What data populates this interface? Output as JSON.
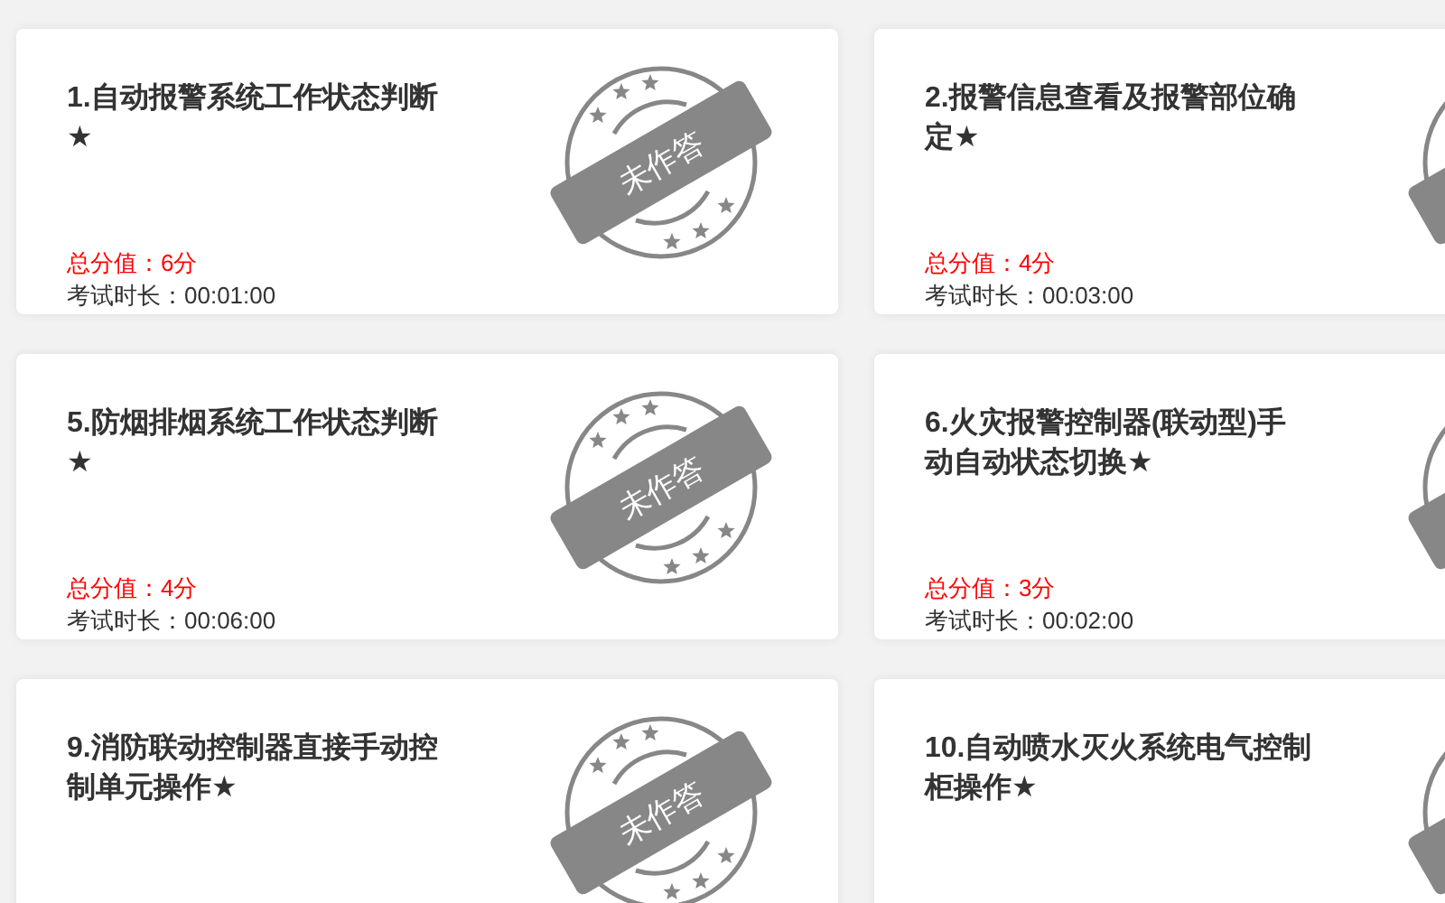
{
  "cards": [
    {
      "title": "1.自动报警系统工作状态判断★",
      "score": "总分值：6分",
      "duration": "考试时长：00:01:00",
      "stamp": {
        "kind": "unanswered",
        "label": "未作答"
      }
    },
    {
      "title": "2.报警信息查看及报警部位确定★",
      "score": "总分值：4分",
      "duration": "考试时长：00:03:00",
      "stamp": {
        "kind": "unanswered"
      }
    },
    {
      "title": "5.防烟排烟系统工作状态判断★",
      "score": "总分值：4分",
      "duration": "考试时长：00:06:00",
      "stamp": {
        "kind": "unanswered",
        "label": "未作答"
      }
    },
    {
      "title": "6.火灾报警控制器(联动型)手动自动状态切换★",
      "score": "总分值：3分",
      "duration": "考试时长：00:02:00",
      "stamp": {
        "kind": "unanswered"
      }
    },
    {
      "title": "9.消防联动控制器直接手动控制单元操作★",
      "stamp": {
        "kind": "unanswered",
        "label": "未作答"
      }
    },
    {
      "title": "10.自动喷水灭火系统电气控制柜操作★",
      "stamp": {
        "kind": "unanswered"
      }
    }
  ]
}
